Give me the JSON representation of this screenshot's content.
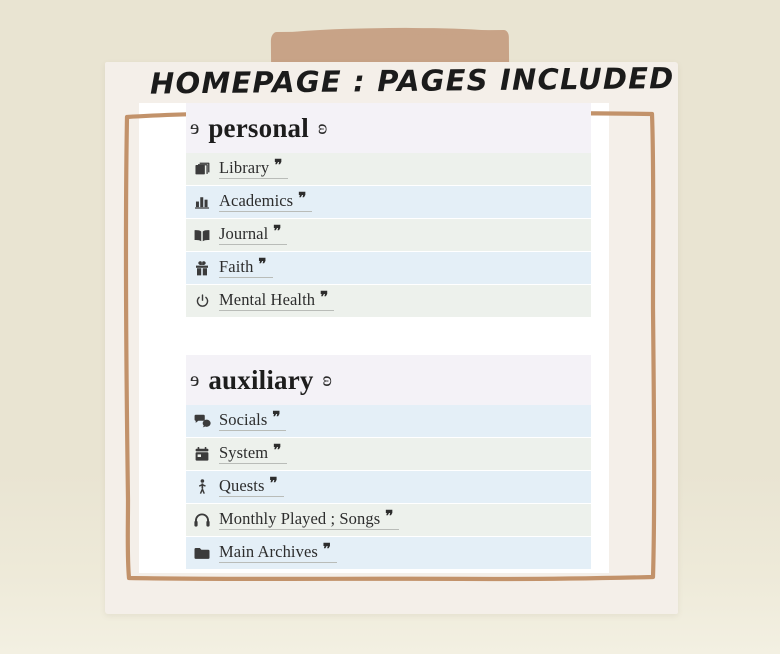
{
  "page": {
    "title": "HOMEPAGE : PAGES INCLUDED",
    "bg_color": "#e9e4d2",
    "card_color": "#f4efe9",
    "sheet_color": "#ffffff",
    "frame_color": "#c2926a",
    "tape_color": "#c8a387"
  },
  "decor": {
    "open_ornament": "ɘ",
    "close_ornament": "ʚ",
    "quote_mark": "❞"
  },
  "sections": [
    {
      "title": "personal",
      "header_bg": "#f4f2f7",
      "items": [
        {
          "label": "Library",
          "icon": "stacked-books-icon",
          "row_bg": "#edf1ec"
        },
        {
          "label": "Academics",
          "icon": "bar-chart-icon",
          "row_bg": "#e4eff7"
        },
        {
          "label": "Journal",
          "icon": "open-book-icon",
          "row_bg": "#edf1ec"
        },
        {
          "label": "Faith",
          "icon": "gift-box-icon",
          "row_bg": "#e4eff7"
        },
        {
          "label": "Mental Health",
          "icon": "power-icon",
          "row_bg": "#edf1ec"
        }
      ]
    },
    {
      "title": "auxiliary",
      "header_bg": "#f4f2f7",
      "items": [
        {
          "label": "Socials",
          "icon": "speech-bubbles-icon",
          "row_bg": "#e4eff7"
        },
        {
          "label": "System",
          "icon": "calendar-icon",
          "row_bg": "#edf1ec"
        },
        {
          "label": "Quests",
          "icon": "walking-person-icon",
          "row_bg": "#e4eff7"
        },
        {
          "label": "Monthly Played ; Songs",
          "icon": "headphones-icon",
          "row_bg": "#edf1ec"
        },
        {
          "label": "Main Archives",
          "icon": "folder-icon",
          "row_bg": "#e4eff7"
        }
      ]
    }
  ]
}
